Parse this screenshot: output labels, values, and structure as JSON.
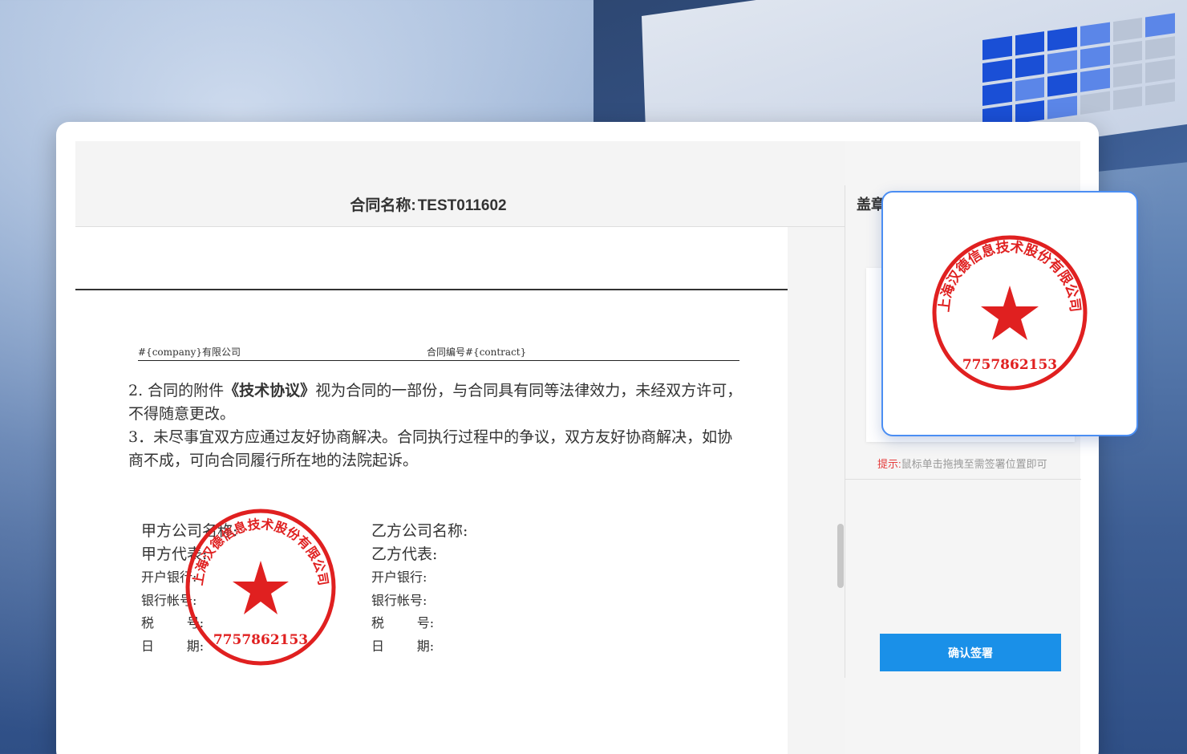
{
  "contract": {
    "title_label": "合同名称:",
    "title_value": "TEST011602"
  },
  "document": {
    "meta_left": "#{company}有限公司",
    "meta_right": "合同编号#{contract}",
    "clause2_prefix": "2.  合同的附件",
    "clause2_bold": "《技术协议》",
    "clause2_rest": "视为合同的一部份，与合同具有同等法律效力，未经双方许可，不得随意更改。",
    "clause3": "3．未尽事宜双方应通过友好协商解决。合同执行过程中的争议，双方友好协商解决，如协商不成，可向合同履行所在地的法院起诉。"
  },
  "party_a": {
    "company": "甲方公司名称:",
    "rep": "甲方代表:",
    "bank": "开户银行:",
    "account": "银行帐号:",
    "tax": "税        号:",
    "date": "日        期:"
  },
  "party_b": {
    "company": "乙方公司名称:",
    "rep": "乙方代表:",
    "bank": "开户银行:",
    "account": "银行帐号:",
    "tax": "税        号:",
    "date": "日        期:"
  },
  "seal": {
    "company": "上海汉德信息技术股份有限公司",
    "code": "7757862153",
    "color": "#e02020"
  },
  "side": {
    "title": "盖章",
    "hint_label": "提示:",
    "hint_text": "鼠标单击拖拽至需签署位置即可",
    "confirm_label": "确认签署"
  },
  "colors": {
    "accent_button": "#1a90e8",
    "popup_border": "#4b8ef3",
    "hint_red": "#e53b3b"
  }
}
